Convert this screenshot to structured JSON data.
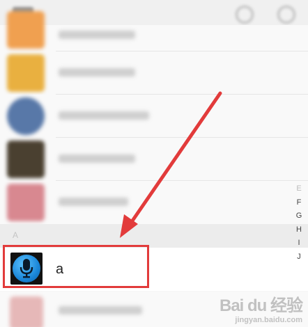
{
  "section": {
    "letter": "A"
  },
  "contact": {
    "name": "a"
  },
  "index": {
    "letters": [
      "E",
      "F",
      "G",
      "H",
      "I",
      "J"
    ],
    "active": [
      "F",
      "G",
      "H",
      "I",
      "J"
    ]
  },
  "overlay": {
    "color": "#e23b3b"
  },
  "watermark": {
    "text": "Bai du 经验",
    "sub": "jingyan.baidu.com"
  }
}
